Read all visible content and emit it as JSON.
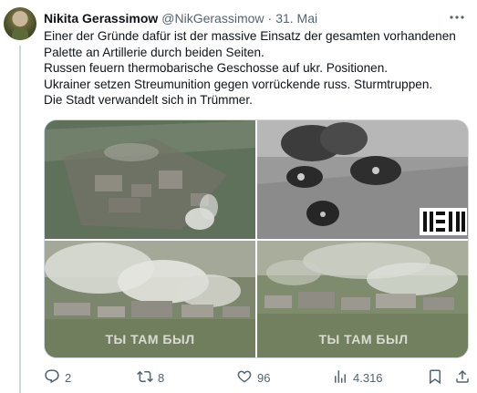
{
  "author": {
    "name": "Nikita Gerassimow",
    "handle": "@NikGerassimow",
    "separator": "·",
    "date": "31. Mai"
  },
  "tweet": {
    "lines": [
      "Einer der Gründe dafür ist der massive Einsatz der gesamten vorhandenen",
      "Palette an Artillerie durch beiden Seiten.",
      "Russen feuern thermobarische Geschosse auf ukr. Positionen.",
      "Ukrainer setzen Streumunition gegen vorrückende russ. Sturmtruppen.",
      "Die Stadt verwandelt sich in Trümmer."
    ]
  },
  "media": {
    "watermark_bottom_left": "ТЫ ТАМ БЫЛ",
    "watermark_bottom_right": "ТЫ ТАМ БЫЛ",
    "logo_text": "ВОЯ"
  },
  "actions": {
    "replies": "2",
    "retweets": "8",
    "likes": "96",
    "views": "4.316"
  },
  "icons": {
    "more": "more-horizontal-icon",
    "reply": "reply-icon",
    "retweet": "retweet-icon",
    "like": "heart-icon",
    "views": "bar-chart-icon",
    "bookmark": "bookmark-icon",
    "share": "share-icon"
  },
  "colors": {
    "text": "#0f1419",
    "secondary": "#536471",
    "border": "#cfd9de"
  }
}
